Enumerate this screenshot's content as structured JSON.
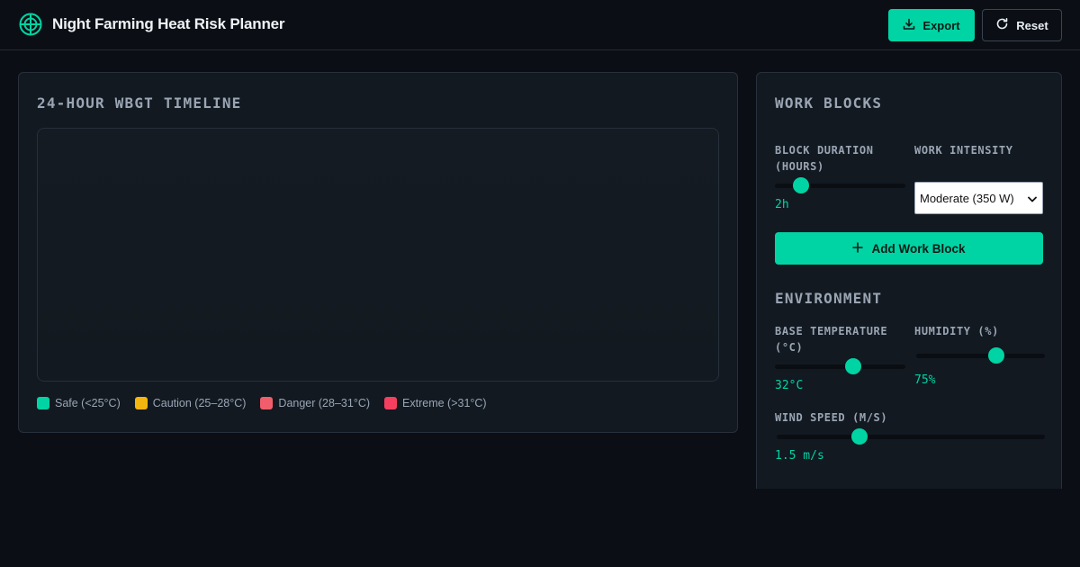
{
  "app": {
    "title": "Night Farming Heat Risk Planner"
  },
  "toolbar": {
    "export_label": "Export",
    "reset_label": "Reset"
  },
  "timeline": {
    "title": "24-HOUR WBGT TIMELINE",
    "legend": [
      {
        "label": "Safe (<25°C)",
        "color": "#00d4a4"
      },
      {
        "label": "Caution (25–28°C)",
        "color": "#f5b50f"
      },
      {
        "label": "Danger (28–31°C)",
        "color": "#f25d6b"
      },
      {
        "label": "Extreme (>31°C)",
        "color": "#f43f5e"
      }
    ]
  },
  "work_blocks": {
    "title": "WORK BLOCKS",
    "duration": {
      "label": "BLOCK DURATION (HOURS)",
      "value_text": "2h",
      "level": 0.2
    },
    "intensity": {
      "label": "WORK INTENSITY",
      "selected": "Moderate (350 W)"
    },
    "add_label": "Add Work Block"
  },
  "environment": {
    "title": "ENVIRONMENT",
    "base_temp": {
      "label": "BASE TEMPERATURE (°C)",
      "value_text": "32°C",
      "level": 0.6
    },
    "humidity": {
      "label": "HUMIDITY (%)",
      "value_text": "75%",
      "level": 0.62
    },
    "wind": {
      "label": "WIND SPEED (M/S)",
      "value_text": "1.5 m/s",
      "level": 0.31
    }
  },
  "colors": {
    "accent": "#00d4a4",
    "background": "#0b0f15",
    "panel": "#121921"
  },
  "icons": {
    "logo": "target-logo-icon",
    "export": "download-icon",
    "reset": "refresh-icon",
    "add": "plus-icon",
    "select": "chevron-down-icon"
  }
}
